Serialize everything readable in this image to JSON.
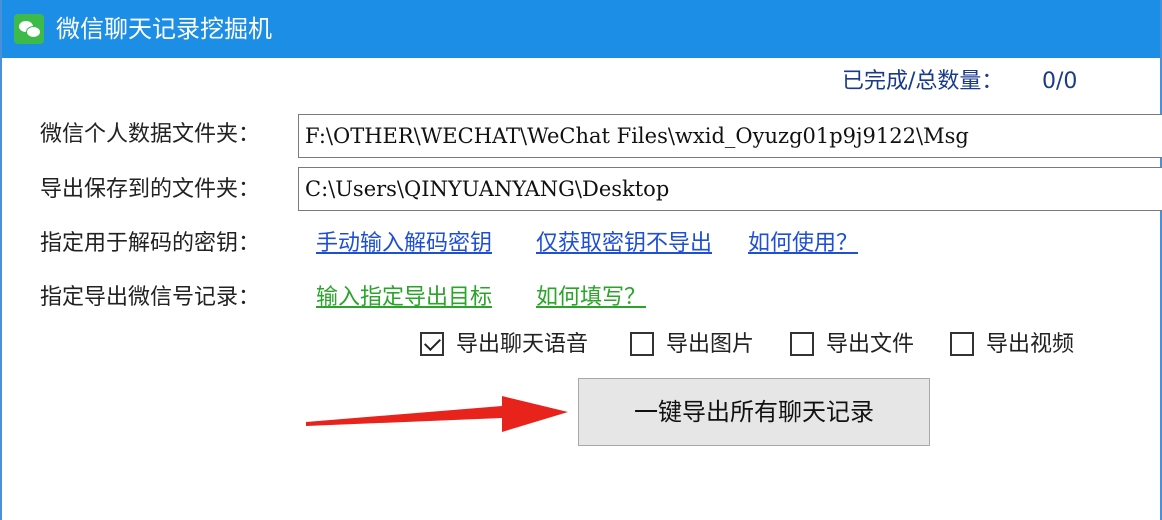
{
  "window": {
    "title": "微信聊天记录挖掘机",
    "app_icon": "wechat-icon"
  },
  "progress": {
    "label": "已完成/总数量：",
    "value": "0/0"
  },
  "fields": {
    "data_folder_label": "微信个人数据文件夹：",
    "data_folder_value": "F:\\OTHER\\WECHAT\\WeChat Files\\wxid_Oyuzg01p9j9122\\Msg",
    "save_folder_label": "导出保存到的文件夹：",
    "save_folder_value": "C:\\Users\\QINYUANYANG\\Desktop"
  },
  "key_row": {
    "label": "指定用于解码的密钥：",
    "manual_input_link": "手动输入解码密钥",
    "fetch_key_link": "仅获取密钥不导出",
    "how_to_use_link": "如何使用？"
  },
  "target_row": {
    "label": "指定导出微信号记录：",
    "input_target_link": "输入指定导出目标",
    "how_to_fill_link": "如何填写？"
  },
  "options": [
    {
      "label": "导出聊天语音",
      "checked": true
    },
    {
      "label": "导出图片",
      "checked": false
    },
    {
      "label": "导出文件",
      "checked": false
    },
    {
      "label": "导出视频",
      "checked": false
    }
  ],
  "export_button_label": "一键导出所有聊天记录",
  "colors": {
    "title_bar": "#1d8ee6",
    "link_blue": "#1f4fd6",
    "link_green": "#2aa52a",
    "progress_text": "#1a3a8c",
    "arrow": "#e8231c"
  }
}
